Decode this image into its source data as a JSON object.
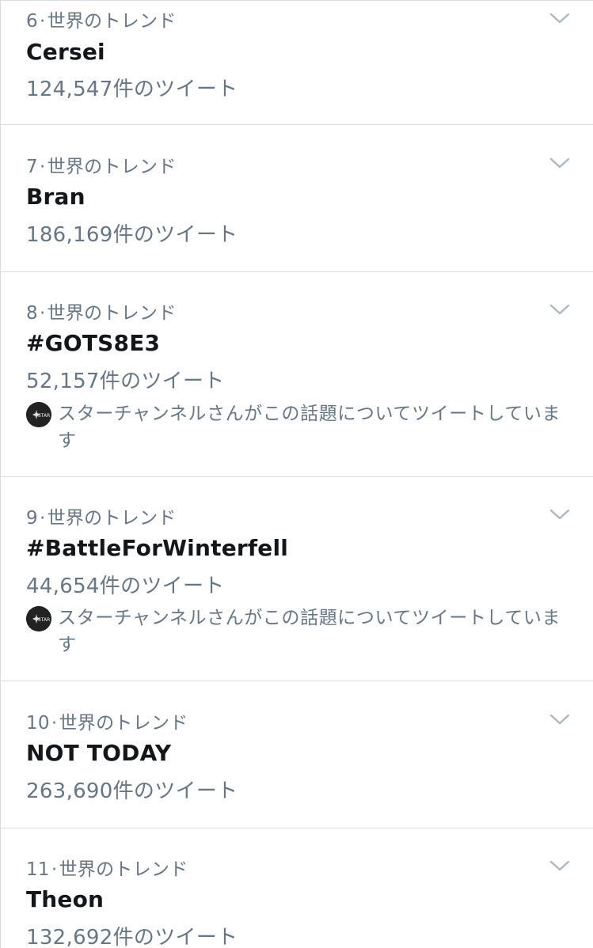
{
  "trends": [
    {
      "rank": "6",
      "label": "世界のトレンド",
      "name": "Cersei",
      "count": "124,547件のツイート",
      "context": null
    },
    {
      "rank": "7",
      "label": "世界のトレンド",
      "name": "Bran",
      "count": "186,169件のツイート",
      "context": null
    },
    {
      "rank": "8",
      "label": "世界のトレンド",
      "name": "#GOTS8E3",
      "count": "52,157件のツイート",
      "context": "スターチャンネルさんがこの話題についてツイートしています"
    },
    {
      "rank": "9",
      "label": "世界のトレンド",
      "name": "#BattleForWinterfell",
      "count": "44,654件のツイート",
      "context": "スターチャンネルさんがこの話題についてツイートしています"
    },
    {
      "rank": "10",
      "label": "世界のトレンド",
      "name": "NOT TODAY",
      "count": "263,690件のツイート",
      "context": null
    },
    {
      "rank": "11",
      "label": "世界のトレンド",
      "name": "Theon",
      "count": "132,692件のツイート",
      "context": null
    }
  ],
  "separator": "·",
  "icons": {
    "chevron": "chevron-down-icon",
    "avatar": "star-channel-avatar"
  },
  "colors": {
    "secondary_text": "#657786",
    "primary_text": "#14171a",
    "divider": "#d9dee3",
    "chevron": "#aab8c2"
  }
}
